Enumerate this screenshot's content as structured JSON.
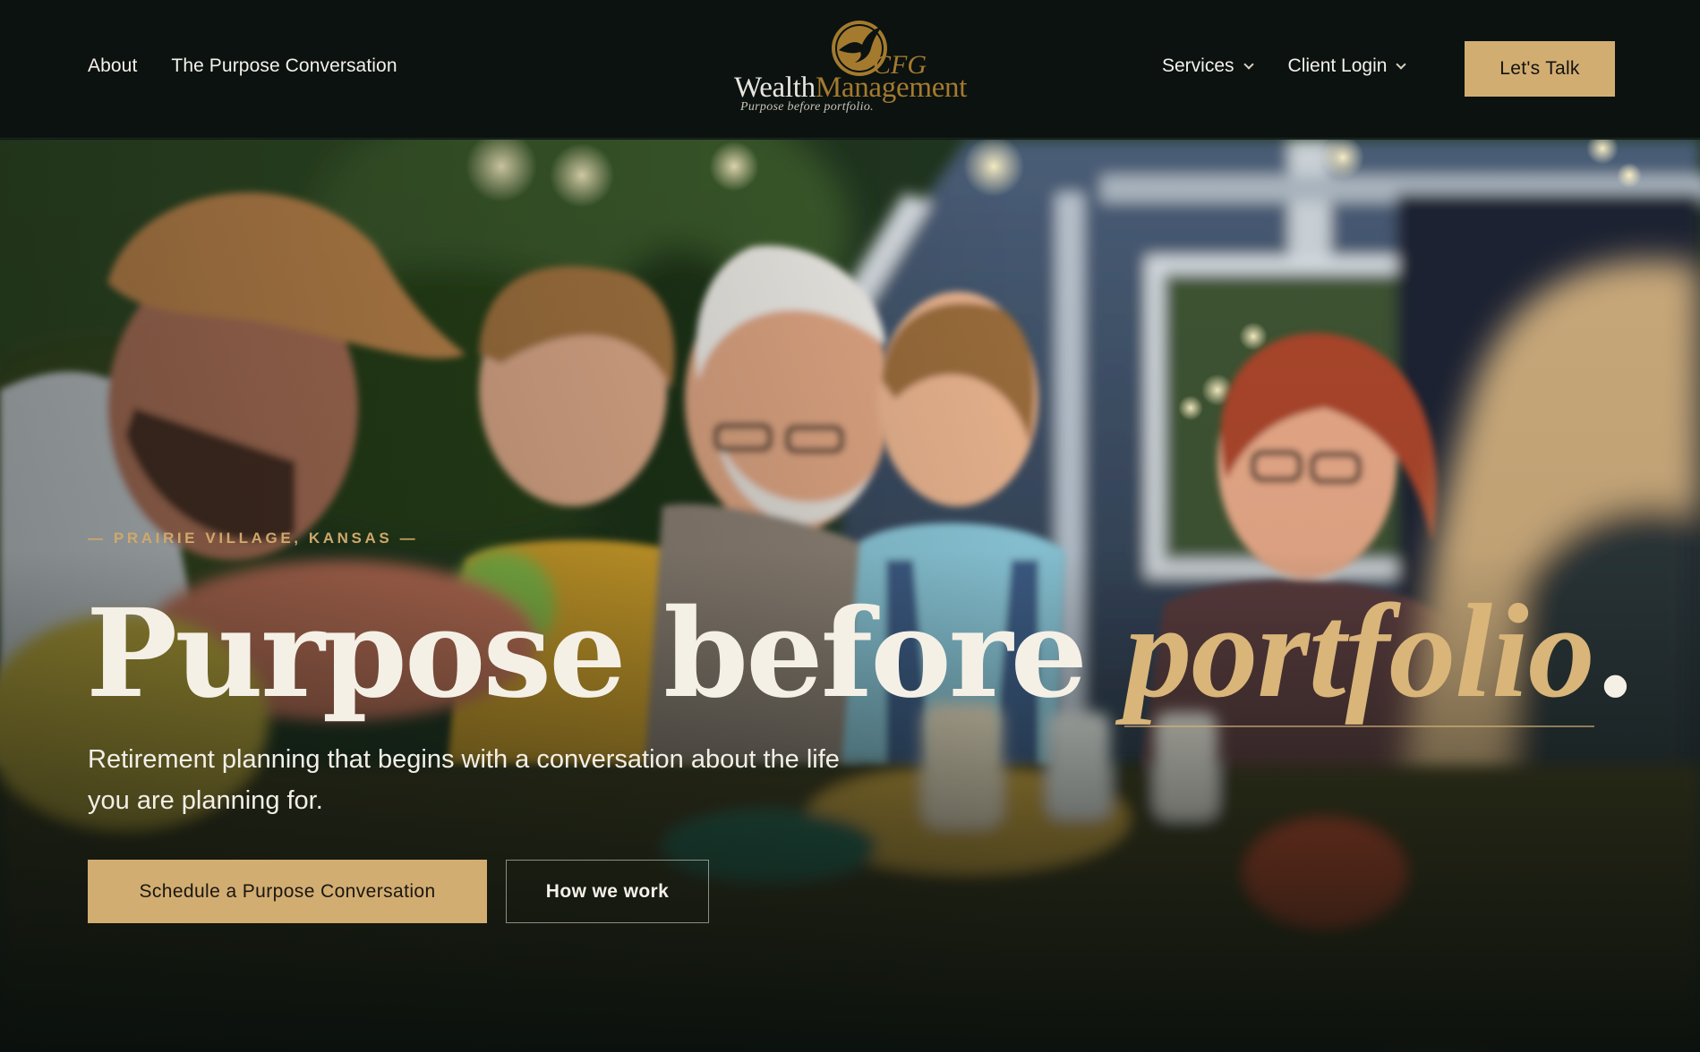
{
  "header": {
    "nav_left": [
      {
        "label": "About"
      },
      {
        "label": "The Purpose Conversation"
      }
    ],
    "logo": {
      "cfg": "CFG",
      "word_1": "Wealth",
      "word_2": "Management",
      "tagline": "Purpose before portfolio."
    },
    "nav_right": [
      {
        "label": "Services",
        "icon": "chevron-down-icon"
      },
      {
        "label": "Client Login",
        "icon": "chevron-down-icon"
      }
    ],
    "cta_label": "Let's Talk"
  },
  "hero": {
    "eyebrow": "— PRAIRIE VILLAGE, KANSAS —",
    "headline_main": "Purpose before ",
    "headline_accent": "portfolio",
    "headline_end": ".",
    "subline": "Retirement planning that begins with a conversation about the life you are planning for.",
    "primary_button": "Schedule a Purpose Conversation",
    "secondary_button": "How we work",
    "image_subject": "family-dinner-photo"
  },
  "colors": {
    "background": "#0b1210",
    "accent_gold": "#d2ad72",
    "logo_bronze": "#a47a2e",
    "text_light": "#f5f0e6"
  }
}
